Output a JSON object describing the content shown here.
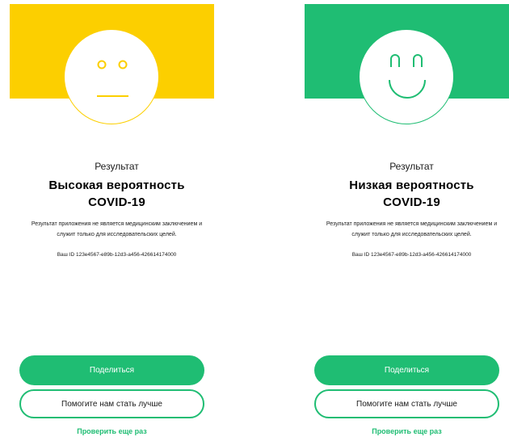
{
  "colors": {
    "yellow": "#fccf00",
    "green": "#1fbd73",
    "text": "#1a1a1a"
  },
  "screens": [
    {
      "face_icon": "neutral-face-icon",
      "subtitle": "Результат",
      "title_line1": "Высокая вероятность",
      "title_line2": "COVID-19",
      "disclaimer": "Результат приложения не является медицинским заключением и служит только для исследовательских целей.",
      "user_id": "Ваш ID 123e4567-e89b-12d3-a456-426614174000",
      "share_label": "Поделиться",
      "help_label": "Помогите нам стать лучше",
      "retry_label": "Проверить еще раз"
    },
    {
      "face_icon": "smiling-face-icon",
      "subtitle": "Результат",
      "title_line1": "Низкая вероятность",
      "title_line2": "COVID-19",
      "disclaimer": "Результат приложения не является медицинским заключением и служит только для исследовательских целей.",
      "user_id": "Ваш ID 123e4567-e89b-12d3-a456-426614174000",
      "share_label": "Поделиться",
      "help_label": "Помогите нам стать лучше",
      "retry_label": "Проверить еще раз"
    }
  ]
}
